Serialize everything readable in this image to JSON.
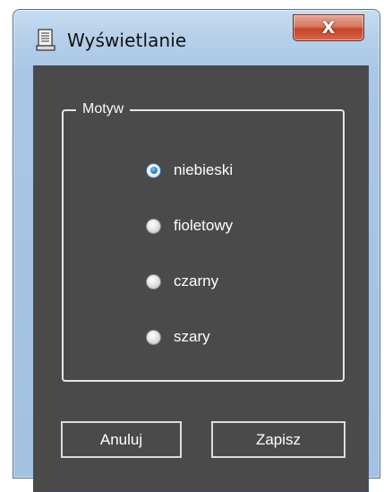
{
  "window": {
    "title": "Wyświetlanie",
    "close_label": "X"
  },
  "theme_group": {
    "legend": "Motyw",
    "options": [
      {
        "label": "niebieski",
        "selected": true
      },
      {
        "label": "fioletowy",
        "selected": false
      },
      {
        "label": "czarny",
        "selected": false
      },
      {
        "label": "szary",
        "selected": false
      }
    ]
  },
  "buttons": {
    "cancel_label": "Anuluj",
    "save_label": "Zapisz"
  },
  "colors": {
    "client_background": "#4a4a4a",
    "text": "#ffffff",
    "selected_radio": "#2a86d2"
  },
  "icons": {
    "title_icon": "document-icon",
    "close_icon": "close-icon"
  }
}
